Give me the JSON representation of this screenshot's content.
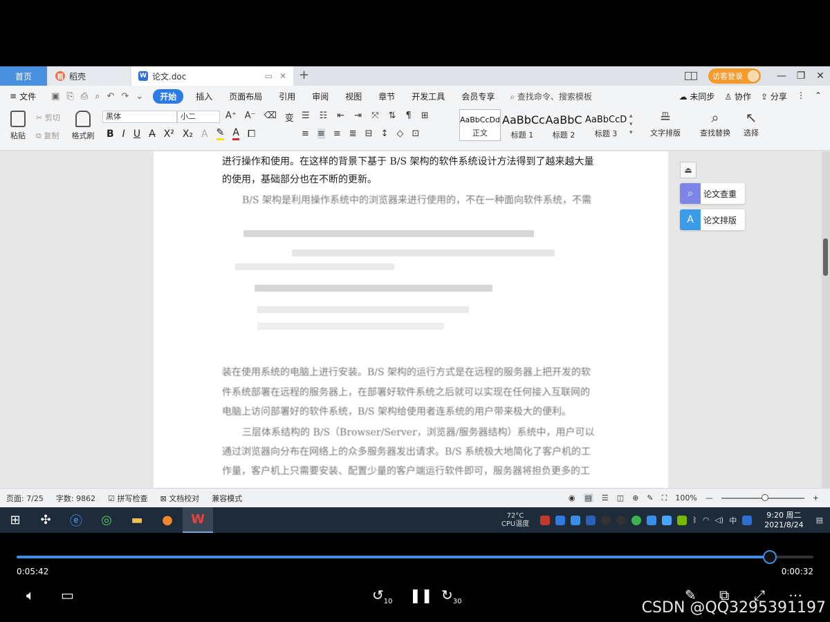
{
  "tabs": {
    "home": "首页",
    "daoke": "稻壳",
    "doc": "论文.doc",
    "new_tab": "+",
    "visitor": "访客登录"
  },
  "menu": {
    "file": "文件",
    "active": "开始",
    "items": [
      "插入",
      "页面布局",
      "引用",
      "审阅",
      "视图",
      "章节",
      "开发工具",
      "会员专享"
    ],
    "search": "查找命令、搜索模板",
    "sync": "未同步",
    "collab": "协作",
    "share": "分享"
  },
  "ribbon": {
    "paste": "粘贴",
    "cut": "剪切",
    "copy": "复制",
    "format_painter": "格式刷",
    "font_name": "黑体",
    "font_size": "小二",
    "styles": [
      {
        "sample": "AaBbCcDd",
        "caption": "正文"
      },
      {
        "sample": "AaBbCc",
        "caption": "标题 1"
      },
      {
        "sample": "AaBbC",
        "caption": "标题 2"
      },
      {
        "sample": "AaBbCcD",
        "caption": "标题 3"
      }
    ],
    "text_layout": "文字排版",
    "find_replace": "查找替换",
    "select": "选择"
  },
  "document": {
    "line1": "进行操作和使用。在这样的背景下基于 B/S 架构的软件系统设计方法得到了越来越大量",
    "line2": "的使用，基础部分也在不断的更新。",
    "line3": "B/S 架构是利用操作系统中的浏览器来进行使用的，不在一种面向软件系统，不需",
    "body_lines": [
      "装在使用系统的电脑上进行安装。B/S 架构的运行方式是在远程的服务器上把开发的软",
      "件系统部署在远程的服务器上，在部署好软件系统之后就可以实现在任何接入互联网的",
      "电脑上访问部署好的软件系统，B/S 架构给使用者连系统的用户带来极大的便利。",
      "三层体系结构的 B/S（Browser/Server，浏览器/服务器结构）系统中，用户可以",
      "通过浏览器向分布在网络上的众多服务器发出请求。B/S 系统极大地简化了客户机的工",
      "作量，客户机上只需要安装、配置少量的客户端运行软件即可，服务器将担负更多的工"
    ]
  },
  "side_panel": {
    "check": "论文查重",
    "layout": "论文排版"
  },
  "status": {
    "page": "页面: 7/25",
    "words": "字数: 9862",
    "spell": "拼写检查",
    "proof": "文档校对",
    "compat": "兼容模式",
    "zoom": "100%"
  },
  "taskbar": {
    "temp": "72°C",
    "cpu": "CPU温度",
    "ime": "中",
    "time": "9:20 周二",
    "date": "2021/8/24"
  },
  "player": {
    "elapsed": "0:05:42",
    "remaining": "0:00:32",
    "progress": 0.945,
    "skip_back": "10",
    "skip_forward": "30",
    "watermark": "CSDN @QQ3295391197"
  },
  "colors": {
    "accent_blue": "#2c7be5",
    "visitor_orange": "#f79a2a",
    "progress_blue": "#3d8fe0"
  }
}
